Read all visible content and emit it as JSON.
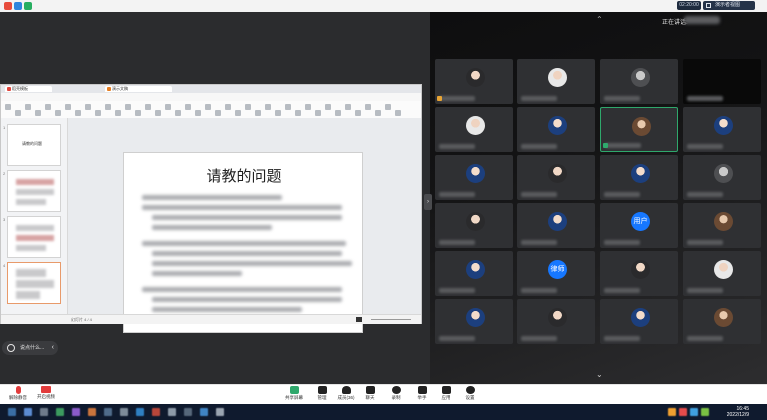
{
  "window": {
    "clock": "02:20:00",
    "view_button": "演示者视图",
    "speaking_label": "正在讲话:"
  },
  "document": {
    "tabs": [
      "稻壳模板",
      "演示文稿"
    ],
    "slide_title": "请教的问题",
    "thumb_title": "请教的问题",
    "slide_numbers": [
      "1",
      "2",
      "3",
      "4"
    ],
    "status_left": "幻灯片 4 / 4"
  },
  "chat": {
    "placeholder": "说点什么..."
  },
  "participants": [
    {
      "avatar": "dark",
      "label": ""
    },
    {
      "avatar": "light",
      "label": ""
    },
    {
      "avatar": "gray",
      "label": ""
    },
    {
      "avatar": "none",
      "label": ""
    },
    {
      "avatar": "light",
      "label": ""
    },
    {
      "avatar": "blue",
      "label": ""
    },
    {
      "avatar": "brown",
      "label": ""
    },
    {
      "avatar": "blue",
      "label": ""
    },
    {
      "avatar": "blue",
      "label": ""
    },
    {
      "avatar": "dark",
      "label": ""
    },
    {
      "avatar": "blue",
      "label": ""
    },
    {
      "avatar": "gray",
      "label": ""
    },
    {
      "avatar": "dark",
      "label": ""
    },
    {
      "avatar": "blue",
      "label": ""
    },
    {
      "avatar": "text",
      "label": "用户"
    },
    {
      "avatar": "brown",
      "label": ""
    },
    {
      "avatar": "blue",
      "label": ""
    },
    {
      "avatar": "text",
      "label": "律师"
    },
    {
      "avatar": "dark",
      "label": ""
    },
    {
      "avatar": "light",
      "label": ""
    },
    {
      "avatar": "blue",
      "label": ""
    },
    {
      "avatar": "dark",
      "label": ""
    },
    {
      "avatar": "blue",
      "label": ""
    },
    {
      "avatar": "brown",
      "label": ""
    }
  ],
  "toolbar": {
    "mute": "解除静音",
    "video": "开启视频",
    "share": "共享屏幕",
    "security": "管理",
    "members": "成员(36)",
    "chat": "聊天",
    "record": "录制",
    "apps": "举手",
    "more": "应用",
    "settings": "设置"
  },
  "taskbar": {
    "time": "16:45",
    "date": "2022/12/9"
  },
  "colors": {
    "meeting_bg": "#2b2c2e",
    "accent_blue": "#1677ff",
    "active_green": "#2fa86c",
    "taskbar": "#0f1a2e"
  }
}
